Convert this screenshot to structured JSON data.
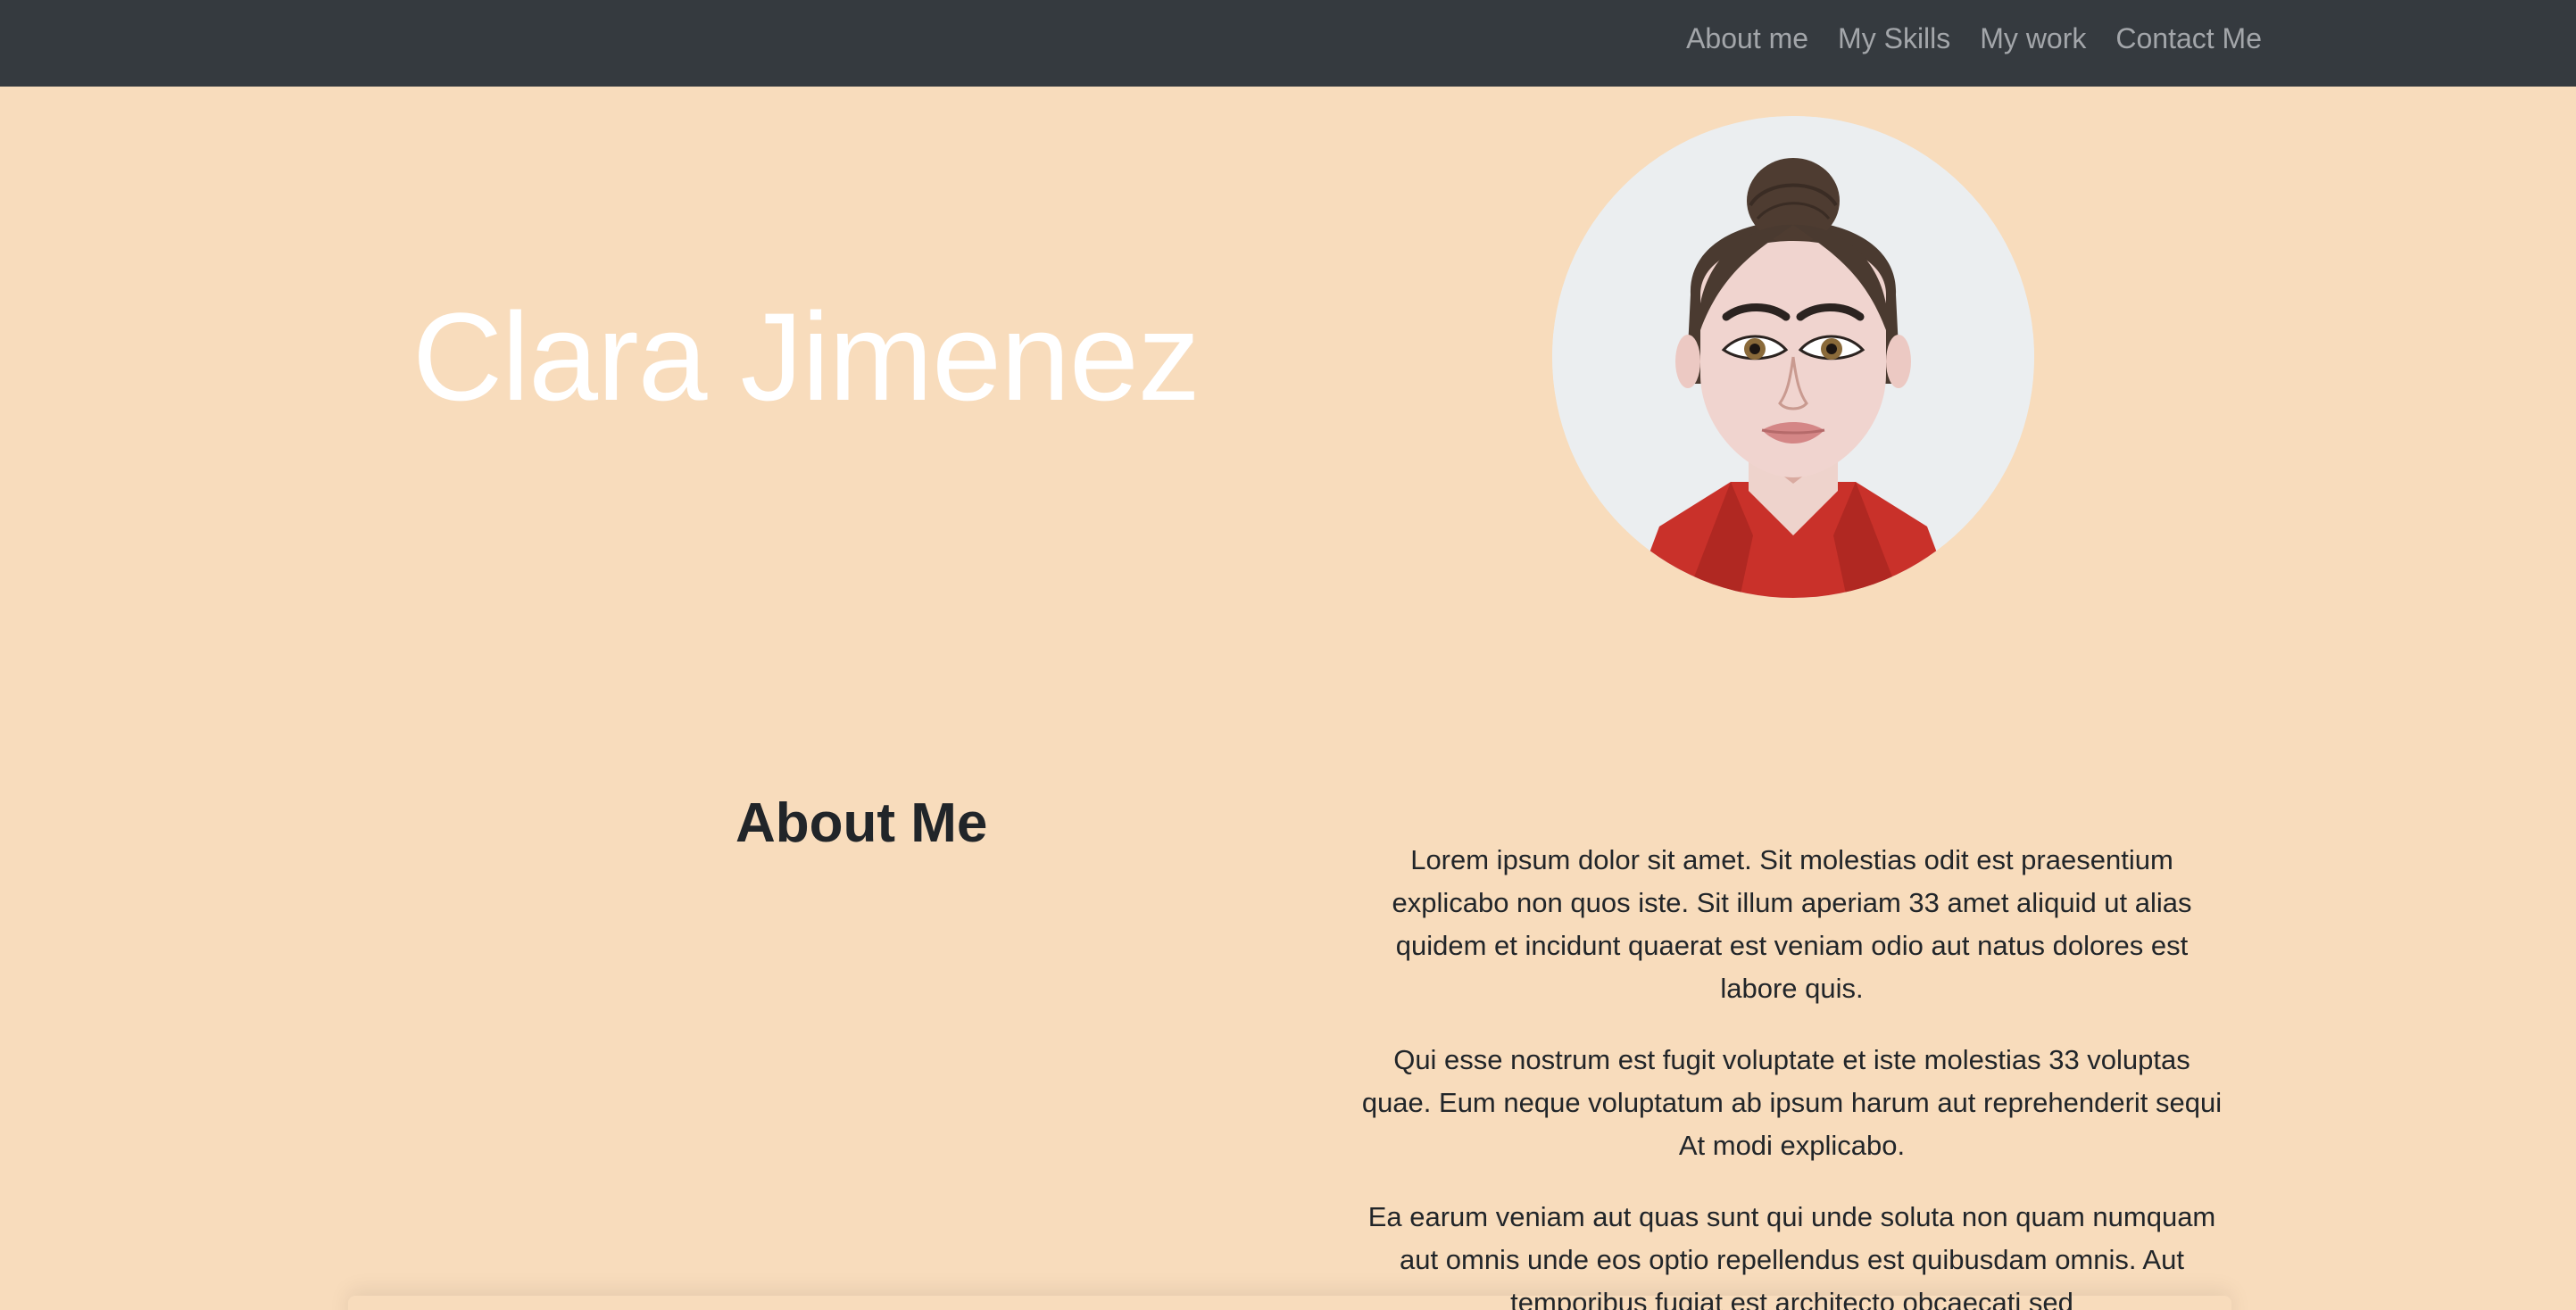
{
  "nav": {
    "items": [
      {
        "label": "About me"
      },
      {
        "label": "My Skills"
      },
      {
        "label": "My work"
      },
      {
        "label": "Contact Me"
      }
    ]
  },
  "hero": {
    "name": "Clara Jimenez"
  },
  "about": {
    "title": "About Me",
    "paragraphs": [
      "Lorem ipsum dolor sit amet. Sit molestias odit est praesentium explicabo non quos iste. Sit illum aperiam 33 amet aliquid ut alias quidem et incidunt quaerat est veniam odio aut natus dolores est labore quis.",
      "Qui esse nostrum est fugit voluptate et iste molestias 33 voluptas quae. Eum neque voluptatum ab ipsum harum aut reprehenderit sequi At modi explicabo.",
      "Ea earum veniam aut quas sunt qui unde soluta non quam numquam aut omnis unde eos optio repellendus est quibusdam omnis. Aut temporibus fugiat est architecto obcaecati sed"
    ]
  },
  "colors": {
    "navbar": "#353a3f",
    "background": "#f8dcbc",
    "nav_link": "#a3a6aa"
  }
}
